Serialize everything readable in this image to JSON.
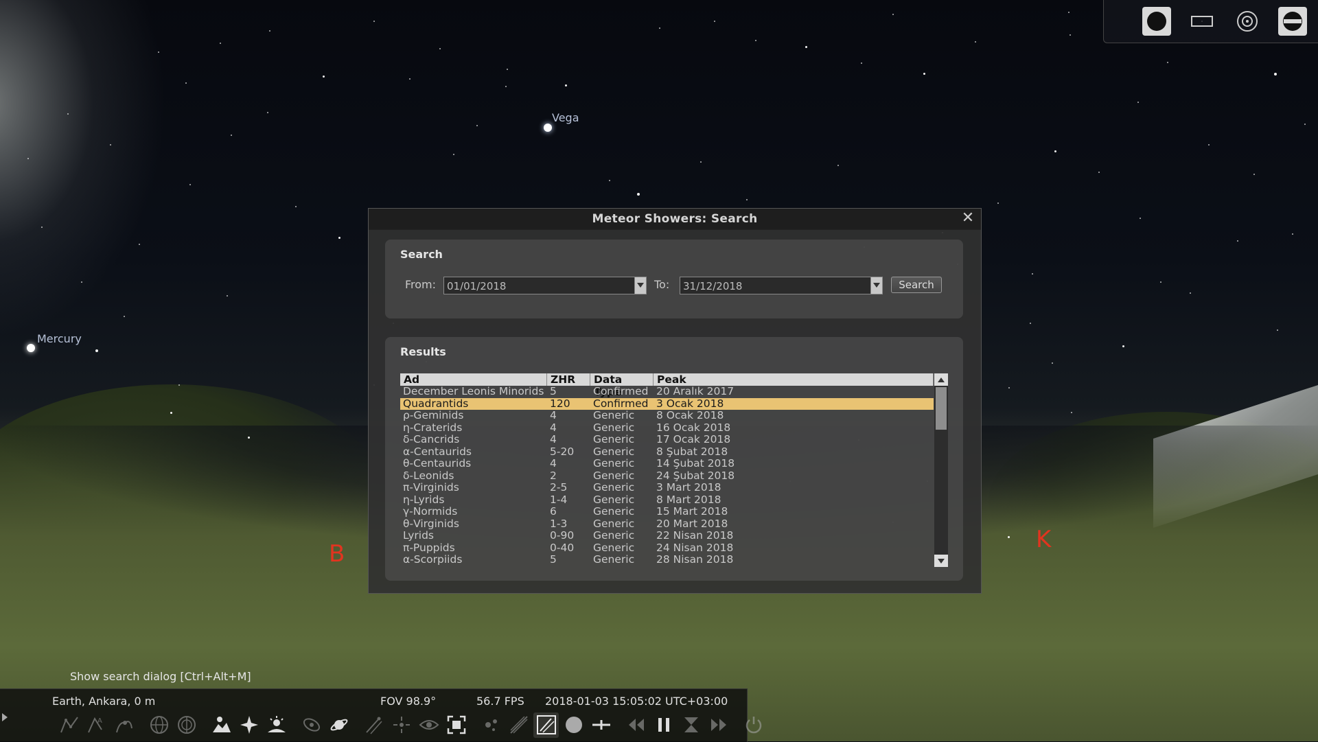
{
  "sky": {
    "labels": {
      "vega": "Vega",
      "mercury": "Mercury"
    },
    "cardinals": {
      "south": "B",
      "west": "K"
    },
    "cardinal_color": "#e2341f"
  },
  "view_panel": {
    "buttons": [
      "circle-view-icon",
      "rectangle-view-icon",
      "target-view-icon",
      "ocular-view-icon"
    ]
  },
  "dialog": {
    "title": "Meteor Showers: Search",
    "search": {
      "group_title": "Search",
      "from_label": "From:",
      "from_value": "01/01/2018",
      "to_label": "To:",
      "to_value": "31/12/2018",
      "button_label": "Search"
    },
    "results": {
      "group_title": "Results",
      "columns": [
        "Ad",
        "ZHR",
        "Data Type",
        "Peak"
      ],
      "selected_index": 1,
      "highlight_color": "#e9c373",
      "rows": [
        [
          "December Leonis Minorids",
          "5",
          "Confirmed",
          "20 Aralık 2017"
        ],
        [
          "Quadrantids",
          "120",
          "Confirmed",
          "3 Ocak 2018"
        ],
        [
          "ρ-Geminids",
          "4",
          "Generic",
          "8 Ocak 2018"
        ],
        [
          "η-Craterids",
          "4",
          "Generic",
          "16 Ocak 2018"
        ],
        [
          "δ-Cancrids",
          "4",
          "Generic",
          "17 Ocak 2018"
        ],
        [
          "α-Centaurids",
          "5-20",
          "Generic",
          "8 Şubat 2018"
        ],
        [
          "θ-Centaurids",
          "4",
          "Generic",
          "14 Şubat 2018"
        ],
        [
          "δ-Leonids",
          "2",
          "Generic",
          "24 Şubat 2018"
        ],
        [
          "π-Virginids",
          "2-5",
          "Generic",
          "3 Mart 2018"
        ],
        [
          "η-Lyrids",
          "1-4",
          "Generic",
          "8 Mart 2018"
        ],
        [
          "γ-Normids",
          "6",
          "Generic",
          "15 Mart 2018"
        ],
        [
          "θ-Virginids",
          "1-3",
          "Generic",
          "20 Mart 2018"
        ],
        [
          "Lyrids",
          "0-90",
          "Generic",
          "22 Nisan 2018"
        ],
        [
          "π-Puppids",
          "0-40",
          "Generic",
          "24 Nisan 2018"
        ],
        [
          "α-Scorpiids",
          "5",
          "Generic",
          "28 Nisan 2018"
        ]
      ]
    }
  },
  "bottom": {
    "tooltip": "Show search dialog  [Ctrl+Alt+M]",
    "location": "Earth, Ankara, 0 m",
    "fov": "FOV 98.9°",
    "fps": "56.7 FPS",
    "datetime": "2018-01-03 15:05:02 UTC+03:00"
  }
}
